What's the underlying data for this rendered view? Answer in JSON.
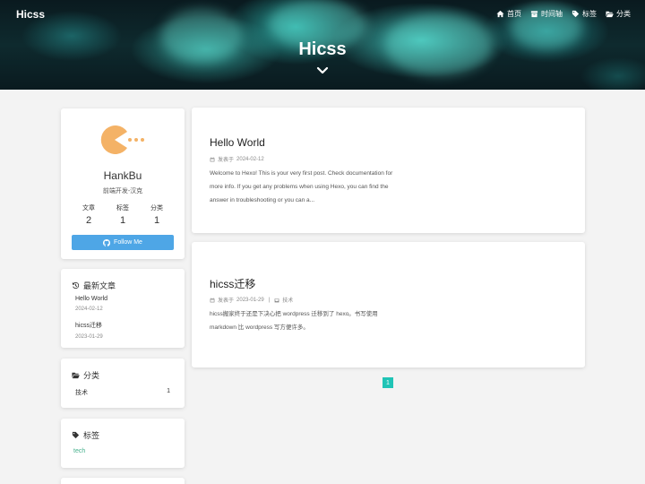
{
  "site": {
    "brand": "Hicss",
    "hero_title": "Hicss"
  },
  "nav": [
    {
      "label": "首页",
      "icon": "home-icon"
    },
    {
      "label": "时间轴",
      "icon": "archive-icon"
    },
    {
      "label": "标签",
      "icon": "tags-icon"
    },
    {
      "label": "分类",
      "icon": "folder-open-icon"
    }
  ],
  "profile": {
    "name": "HankBu",
    "description": "前端开发-汉克",
    "stats": [
      {
        "label": "文章",
        "value": "2"
      },
      {
        "label": "标签",
        "value": "1"
      },
      {
        "label": "分类",
        "value": "1"
      }
    ],
    "follow_label": "Follow Me",
    "avatar_color": "#f4b266"
  },
  "recent_posts": {
    "title": "最新文章",
    "items": [
      {
        "title": "Hello World",
        "date": "2024-02-12"
      },
      {
        "title": "hicss迁移",
        "date": "2023-01-29"
      }
    ]
  },
  "categories": {
    "title": "分类",
    "items": [
      {
        "name": "技术",
        "count": "1"
      }
    ]
  },
  "tags": {
    "title": "标签",
    "items": [
      "tech"
    ]
  },
  "posts": [
    {
      "title": "Hello World",
      "date_prefix": "发表于",
      "date": "2024-02-12",
      "excerpt": "Welcome to Hexo! This is your very first post. Check documentation for more info. If you get any problems when using Hexo, you can find the answer in troubleshooting or you can a..."
    },
    {
      "title": "hicss迁移",
      "date_prefix": "发表于",
      "date": "2023-01-29",
      "separator": "|",
      "category": "技术",
      "excerpt": "hicss搬家终于还是下决心把 wordpress 迁移到了 hexo。书写使用 markdown 比 wordpress 写方便许多。"
    }
  ],
  "pagination": {
    "current": "1"
  },
  "colors": {
    "accent_teal": "#20c4b6",
    "follow_blue": "#4ea6e6",
    "tag_green": "#45b08c"
  }
}
